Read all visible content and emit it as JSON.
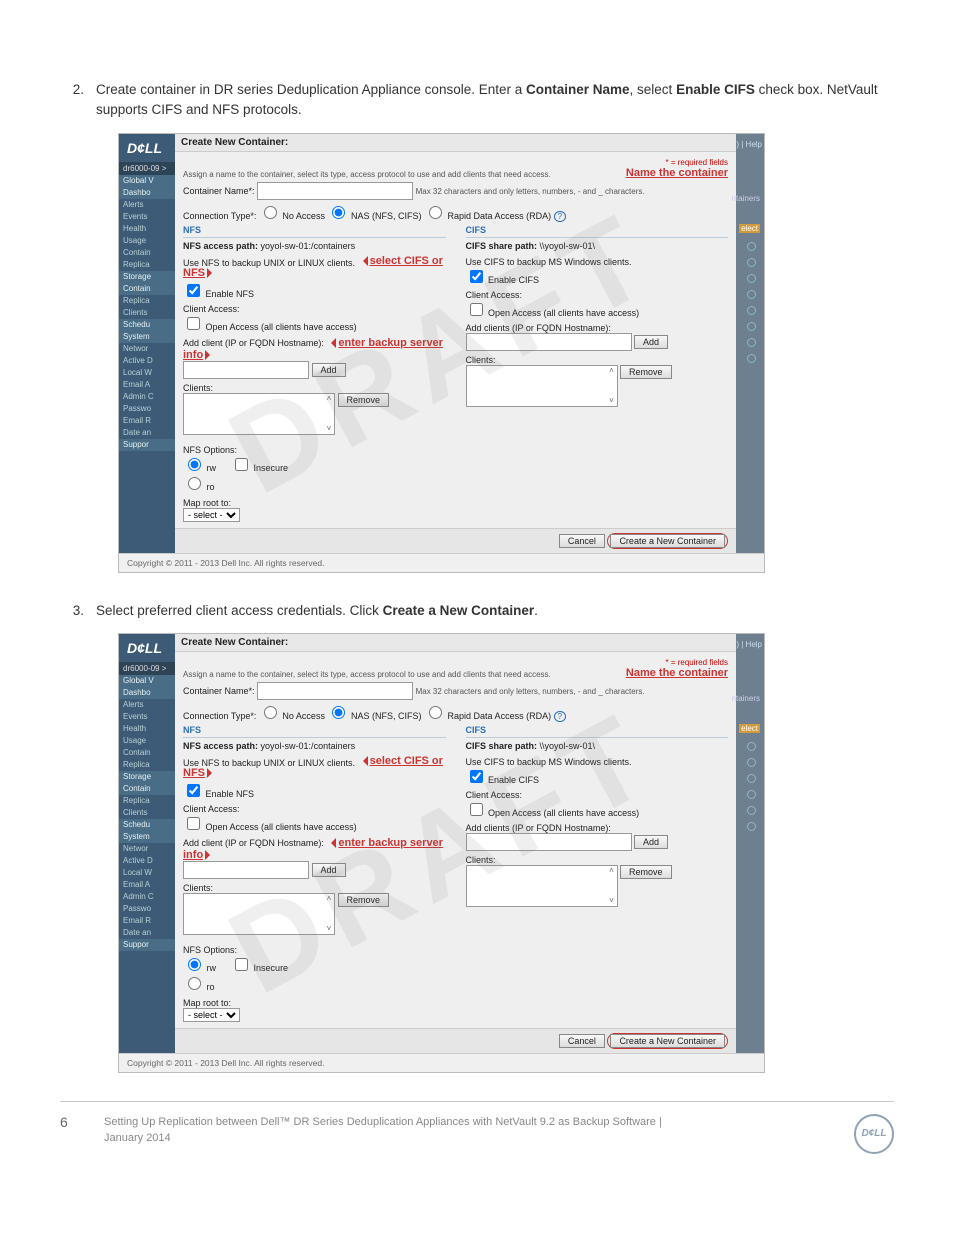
{
  "steps": {
    "s2": {
      "num": "2.",
      "text_a": "Create container in DR series Deduplication Appliance console. Enter a ",
      "bold1": "Container Name",
      "text_b": ", select ",
      "bold2": "Enable CIFS",
      "text_c": " check box. NetVault supports CIFS and NFS protocols."
    },
    "s3": {
      "num": "3.",
      "text_a": "Select preferred client access credentials. Click ",
      "bold1": "Create a New Container",
      "text_b": "."
    }
  },
  "dialog": {
    "title": "Create New Container:",
    "required_note": "* = required fields",
    "help": ") | Help",
    "intro": "Assign a name to the container, select its type, access protocol to use and add clients that need access.",
    "annot_name": "Name the container",
    "container_name_label": "Container Name*:",
    "container_name_hint": "Max 32 characters and only letters, numbers, - and _ characters.",
    "breadcrumb": "dr6000-09 >",
    "conntype_label": "Connection Type*:",
    "ct_no": "No Access",
    "ct_nas": "NAS (NFS, CIFS)",
    "ct_rda": "Rapid Data Access (RDA)",
    "help_q": "?",
    "nfs": {
      "head": "NFS",
      "path_label": "NFS access path:",
      "path": "yoyol-sw-01:/containers",
      "desc": "Use NFS to backup UNIX or LINUX clients.",
      "annot": "select CIFS or NFS",
      "enable": "Enable NFS",
      "client_access": "Client Access:",
      "open": "Open Access (all clients have access)",
      "add_label": "Add client (IP or FQDN Hostname):",
      "annot2": "enter backup server info",
      "add_btn": "Add",
      "clients": "Clients:",
      "remove": "Remove",
      "options": "NFS Options:",
      "rw": "rw",
      "ro": "ro",
      "insecure": "Insecure",
      "maproot": "Map root to:",
      "maproot_val": "- select -"
    },
    "cifs": {
      "head": "CIFS",
      "path_label": "CIFS share path:",
      "path": "\\\\yoyol-sw-01\\",
      "desc": "Use CIFS to backup MS Windows clients.",
      "enable": "Enable CIFS",
      "client_access": "Client Access:",
      "open": "Open Access (all clients have access)",
      "add_label": "Add clients (IP or FQDN Hostname):",
      "add_btn": "Add",
      "clients": "Clients:",
      "remove": "Remove"
    },
    "cancel": "Cancel",
    "create": "Create a New Container",
    "copyright": "Copyright © 2011 - 2013 Dell Inc. All rights reserved."
  },
  "sidebar": {
    "items": [
      {
        "label": "Global V",
        "group": true
      },
      {
        "label": "Dashbo",
        "group": true
      },
      {
        "label": "Alerts"
      },
      {
        "label": "Events"
      },
      {
        "label": "Health"
      },
      {
        "label": "Usage"
      },
      {
        "label": "Contain"
      },
      {
        "label": "Replica"
      },
      {
        "label": "Storage",
        "group": true
      },
      {
        "label": "Contain",
        "group": true
      },
      {
        "label": "Replica"
      },
      {
        "label": "Clients"
      },
      {
        "label": "Schedu",
        "group": true
      },
      {
        "label": "System",
        "group": true
      },
      {
        "label": "Networ"
      },
      {
        "label": "Active D"
      },
      {
        "label": "Local W"
      },
      {
        "label": "Email A"
      },
      {
        "label": "Admin C"
      },
      {
        "label": "Passwo"
      },
      {
        "label": "Email R"
      },
      {
        "label": "Date an"
      },
      {
        "label": "Suppor",
        "group": true
      }
    ]
  },
  "rightshade": {
    "hint": ") | Help",
    "ntainers": "ntainers",
    "elect": "elect"
  },
  "footer": {
    "page": "6",
    "line1": "Setting Up Replication between Dell™ DR Series Deduplication Appliances with NetVault 9.2 as Backup Software |",
    "line2": "January 2014",
    "logo": "D¢LL"
  },
  "draft": "DRAFT"
}
